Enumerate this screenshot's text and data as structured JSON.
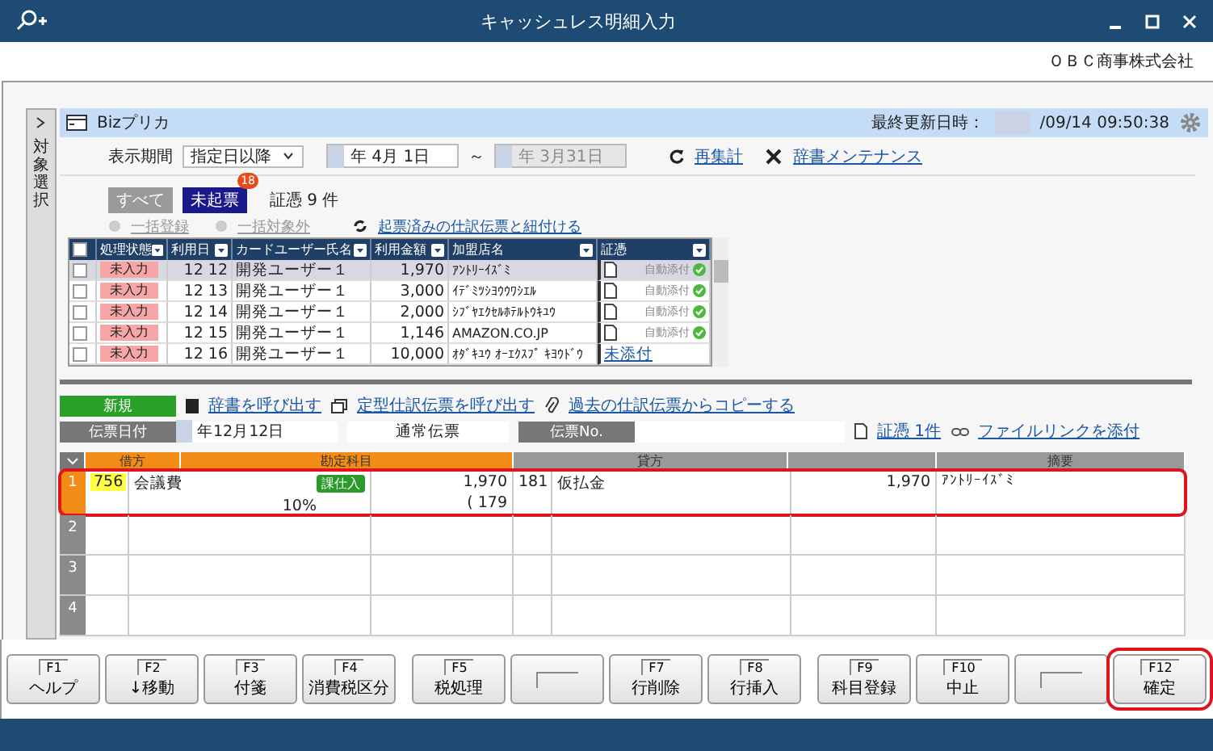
{
  "window": {
    "title": "キャッシュレス明細入力",
    "company": "ＯＢＣ商事株式会社"
  },
  "side_tab": {
    "label": "対象選択"
  },
  "panel": {
    "title": "Bizプリカ",
    "updated_label": "最終更新日時：",
    "updated": "/09/14 09:50:38"
  },
  "period": {
    "label": "表示期間",
    "mode": "指定日以降",
    "from": "年  4月  1日",
    "separator": "～",
    "to": "年  3月31日",
    "links": [
      "再集計",
      "辞書メンテナンス"
    ]
  },
  "filters": [
    {
      "label": "すべて",
      "selected": false
    },
    {
      "label": "未起票",
      "selected": true,
      "badge": "18"
    }
  ],
  "count": "証憑 9 件",
  "bulk_actions": [
    {
      "label": "一括登録",
      "disabled": true
    },
    {
      "label": "一括対象外",
      "disabled": true
    }
  ],
  "link_action": "起票済みの仕訳伝票と紐付ける",
  "table": {
    "columns": [
      "処理状態",
      "利用日",
      "カードユーザー氏名",
      "利用金額",
      "加盟店名",
      "証憑"
    ],
    "rows": [
      {
        "checked": false,
        "selected": true,
        "status": "未入力",
        "date": "12 12",
        "user": "開発ユーザー１",
        "amount": "1,970",
        "store": "ｱﾝﾄﾘｰｲｽﾞﾐ",
        "evidence": {
          "kind": "attached",
          "label": "自動添付"
        }
      },
      {
        "checked": false,
        "selected": false,
        "status": "未入力",
        "date": "12 13",
        "user": "開発ユーザー１",
        "amount": "3,000",
        "store": "ｲﾃﾞﾐﾂｼﾖｳｳﾜｼｴﾙ",
        "evidence": {
          "kind": "attached",
          "label": "自動添付"
        }
      },
      {
        "checked": false,
        "selected": false,
        "status": "未入力",
        "date": "12 14",
        "user": "開発ユーザー１",
        "amount": "2,000",
        "store": "ｼﾌﾞﾔｴｸｾﾙﾎﾃﾙﾄｳｷﾕｳ",
        "evidence": {
          "kind": "attached",
          "label": "自動添付"
        }
      },
      {
        "checked": false,
        "selected": false,
        "status": "未入力",
        "date": "12 15",
        "user": "開発ユーザー１",
        "amount": "1,146",
        "store": "AMAZON.CO.JP",
        "evidence": {
          "kind": "attached",
          "label": "自動添付"
        }
      },
      {
        "checked": false,
        "selected": false,
        "status": "未入力",
        "date": "12 16",
        "user": "開発ユーザー１",
        "amount": "10,000",
        "store": "ｵﾀﾞｷﾕｳ ｵｰｴｸｽﾌﾟ ｷﾖｳﾄﾞｳ",
        "evidence": {
          "kind": "link",
          "label": "未添付"
        }
      }
    ]
  },
  "entry": {
    "new_label": "新規",
    "links": [
      "辞書を呼び出す",
      "定型仕訳伝票を呼び出す",
      "過去の仕訳伝票からコピーする"
    ],
    "date_label": "伝票日付",
    "date": "年12月12日",
    "type": "通常伝票",
    "no_label": "伝票No.",
    "evidence_link": "証憑 1件",
    "file_link": "ファイルリンクを添付"
  },
  "grid": {
    "expanded": true,
    "headers": [
      "借方",
      "勘定科目",
      "貸方",
      "摘要"
    ],
    "rows": [
      {
        "num": "1",
        "selected": true,
        "highlighted": true,
        "debit_code": "756",
        "debit_account": "会議費",
        "tax_tag": "課仕入",
        "tax_rate": "10%",
        "debit_amount": "1,970",
        "tax_amount": "( 179",
        "credit_code": "181",
        "credit_account": "仮払金",
        "credit_amount": "1,970",
        "summary": "ｱﾝﾄﾘｰｲｽﾞﾐ"
      },
      {
        "num": "2",
        "selected": false,
        "highlighted": false
      },
      {
        "num": "3",
        "selected": false,
        "highlighted": false
      },
      {
        "num": "4",
        "selected": false,
        "highlighted": false
      }
    ]
  },
  "function_keys": [
    {
      "key": "F1",
      "label": "ヘルプ"
    },
    {
      "key": "F2",
      "label": "↓移動"
    },
    {
      "key": "F3",
      "label": "付箋"
    },
    {
      "key": "F4",
      "label": "消費税区分"
    },
    {
      "key": "F5",
      "label": "税処理"
    },
    {
      "kind": "empty"
    },
    {
      "key": "F7",
      "label": "行削除"
    },
    {
      "key": "F8",
      "label": "行挿入"
    },
    {
      "key": "F9",
      "label": "科目登録"
    },
    {
      "key": "F10",
      "label": "中止"
    },
    {
      "kind": "empty"
    },
    {
      "key": "F12",
      "label": "確定",
      "highlighted": true
    }
  ]
}
